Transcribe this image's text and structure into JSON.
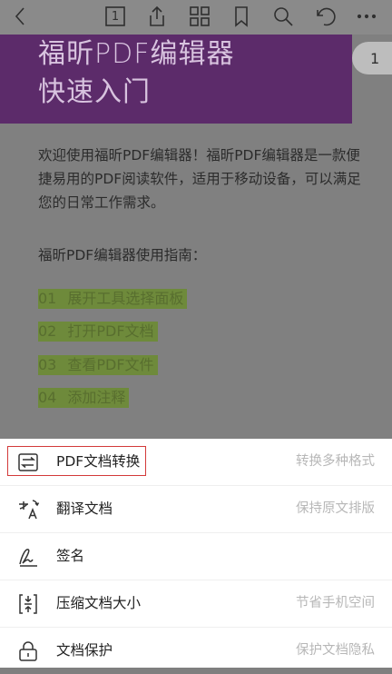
{
  "toolbar": {
    "page_number": "1",
    "icons": [
      "back-icon",
      "page-number-icon",
      "share-icon",
      "thumbnails-icon",
      "bookmark-icon",
      "search-icon",
      "undo-icon",
      "more-icon"
    ]
  },
  "document": {
    "banner_line1": "福昕PDF编辑器",
    "banner_line2": "快速入门",
    "page_badge": "1",
    "intro": "欢迎使用福昕PDF编辑器！福昕PDF编辑器是一款便捷易用的PDF阅读软件，适用于移动设备，可以满足您的日常工作需求。",
    "guide_title": "福昕PDF编辑器使用指南：",
    "steps": [
      {
        "num": "01",
        "text": "展开工具选择面板"
      },
      {
        "num": "02",
        "text": "打开PDF文档"
      },
      {
        "num": "03",
        "text": "查看PDF文件"
      },
      {
        "num": "04",
        "text": "添加注释"
      }
    ],
    "highlight_color": "#6e8a3b",
    "banner_color": "#5c2b6a"
  },
  "sheet": {
    "items": [
      {
        "label": "PDF文档转换",
        "desc": "转换多种格式",
        "icon": "convert-icon"
      },
      {
        "label": "翻译文档",
        "desc": "保持原文排版",
        "icon": "translate-icon"
      },
      {
        "label": "签名",
        "desc": "",
        "icon": "signature-icon"
      },
      {
        "label": "压缩文档大小",
        "desc": "节省手机空间",
        "icon": "compress-icon"
      },
      {
        "label": "文档保护",
        "desc": "保护文档隐私",
        "icon": "lock-icon"
      }
    ],
    "selected_border_color": "#d33a3a"
  }
}
